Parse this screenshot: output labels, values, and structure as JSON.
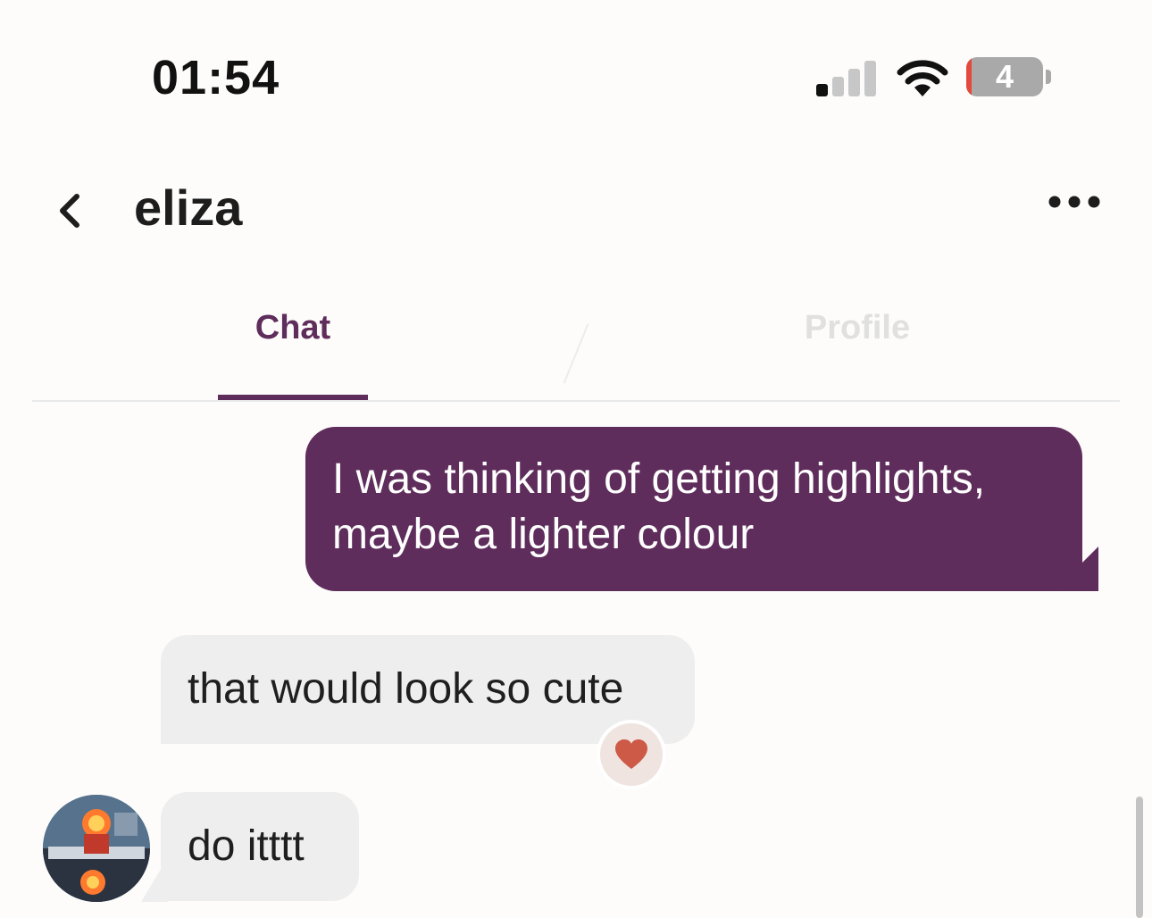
{
  "status_bar": {
    "time": "01:54",
    "battery_level": "4",
    "signal_bars_active": 1,
    "signal_bars_total": 4
  },
  "header": {
    "contact_name": "eliza",
    "back_icon": "chevron-left-icon",
    "more_icon": "ellipsis-icon"
  },
  "tabs": [
    {
      "label": "Chat",
      "active": true
    },
    {
      "label": "Profile",
      "active": false
    }
  ],
  "messages": [
    {
      "direction": "outgoing",
      "text": "I was thinking of getting highlights, maybe a lighter colour"
    },
    {
      "direction": "incoming",
      "text": "that would look so cute",
      "reaction": "heart-icon"
    },
    {
      "direction": "incoming",
      "text": "do itttt"
    }
  ],
  "colors": {
    "brand": "#5f2d5c",
    "incoming_bubble": "#eeeeee",
    "reaction_heart": "#cc5a47",
    "battery_low": "#e34a3b"
  }
}
